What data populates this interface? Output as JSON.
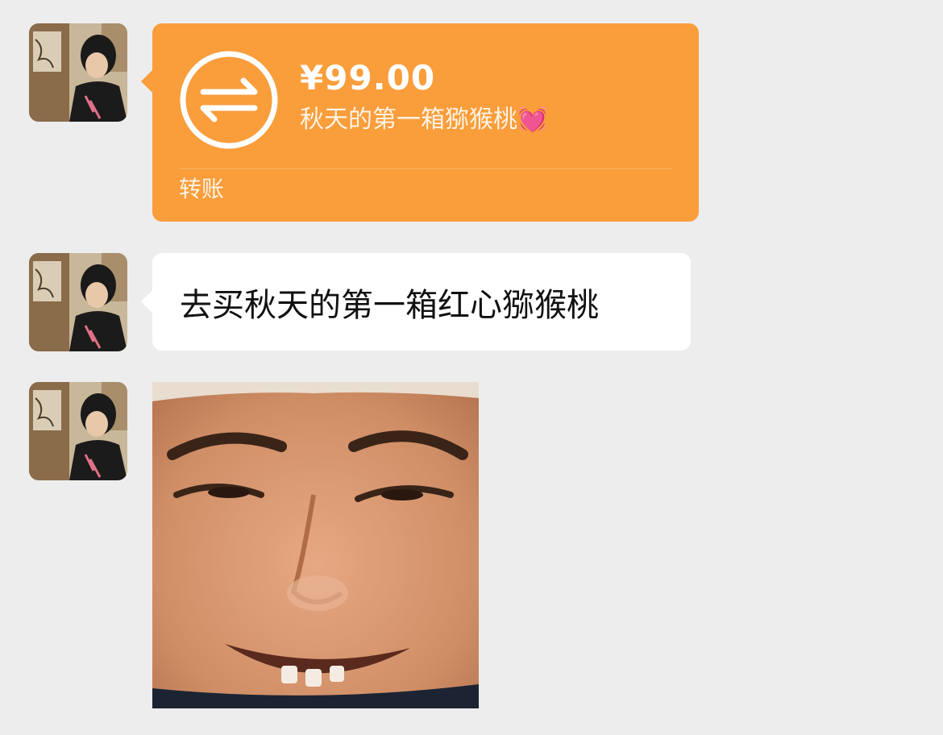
{
  "messages": [
    {
      "type": "transfer",
      "amount": "¥99.00",
      "note": "秋天的第一箱猕猴桃💓",
      "label": "转账",
      "icon": "transfer-arrows-icon",
      "bubble_color": "#fa9d3b"
    },
    {
      "type": "text",
      "text": "去买秋天的第一箱红心猕猴桃",
      "bubble_color": "#ffffff"
    },
    {
      "type": "sticker",
      "description": "smiling-face-sticker"
    }
  ],
  "theme": {
    "background": "#ededed",
    "transfer_orange": "#fa9d3b",
    "text_color": "#111111"
  }
}
